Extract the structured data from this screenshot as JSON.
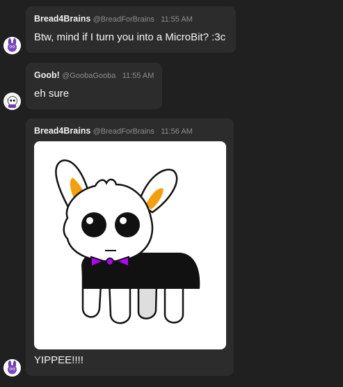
{
  "messages": [
    {
      "name": "Bread4Brains",
      "handle": "@BreadForBrains",
      "time": "11:55 AM",
      "text": "Btw, mind if I turn you into a MicroBit? :3c"
    },
    {
      "name": "Goob!",
      "handle": "@GoobaGooba",
      "time": "11:55 AM",
      "text": "eh sure"
    },
    {
      "name": "Bread4Brains",
      "handle": "@BreadForBrains",
      "time": "11:56 AM",
      "text": "YIPPEE!!!!"
    }
  ],
  "icons": {
    "avatar_bread": "avatar-purple-bunny",
    "avatar_goob": "avatar-goob",
    "attachment": "white-creature-drawing"
  },
  "colors": {
    "background": "#202020",
    "bubble": "#2c2c2c",
    "bowtie": "#b400ff",
    "ears": "#f5a00a",
    "avatar_purple": "#6a3bb5"
  }
}
